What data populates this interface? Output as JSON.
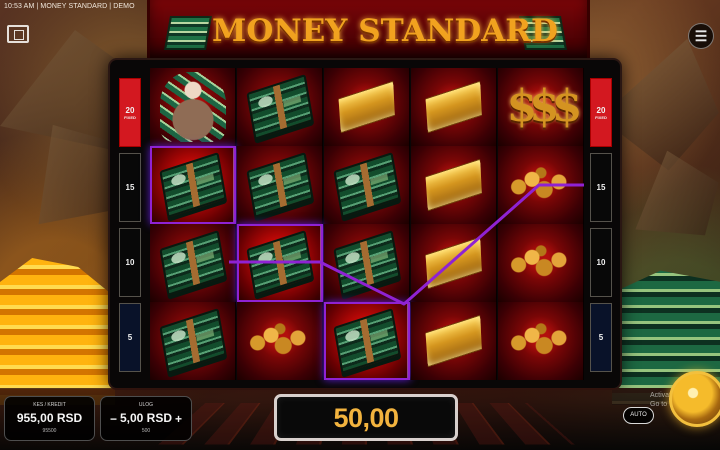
{
  "status": {
    "text": "10:53 AM | MONEY STANDARD | DEMO"
  },
  "game": {
    "title": "MONEY STANDARD",
    "win_amount": "50,00",
    "auto_label": "AUTO",
    "watermark": "Activate Windows\nGo to Settings"
  },
  "credit": {
    "label": "KES / KREDIT",
    "value": "955,00 RSD",
    "sub": "95500"
  },
  "bet": {
    "label": "ULOG",
    "value": "5,00 RSD",
    "sub": "500",
    "minus": "−",
    "plus": "+"
  },
  "lines": {
    "left": [
      {
        "value": "20",
        "fixed": "FIXED",
        "style": "active"
      },
      {
        "value": "15",
        "fixed": "",
        "style": "dark"
      },
      {
        "value": "10",
        "fixed": "",
        "style": "dark"
      },
      {
        "value": "5",
        "fixed": "",
        "style": "blue"
      }
    ],
    "right": [
      {
        "value": "20",
        "fixed": "FIXED",
        "style": "active"
      },
      {
        "value": "15",
        "fixed": "",
        "style": "dark"
      },
      {
        "value": "10",
        "fixed": "",
        "style": "dark"
      },
      {
        "value": "5",
        "fixed": "",
        "style": "blue"
      }
    ]
  },
  "reels": [
    [
      "wild",
      "money",
      "money",
      "money"
    ],
    [
      "money",
      "money",
      "money",
      "coins"
    ],
    [
      "gold",
      "money",
      "money",
      "money"
    ],
    [
      "gold",
      "gold",
      "gold",
      "gold"
    ],
    [
      "dollar",
      "coins",
      "coins",
      "coins"
    ]
  ],
  "icons": {
    "menu": "menu-icon",
    "fullscreen": "fullscreen-icon",
    "spin": "spin-icon"
  },
  "colors": {
    "win_line": "#8f22d3",
    "win_text": "#f2b33e",
    "active_line": "#d31820"
  }
}
